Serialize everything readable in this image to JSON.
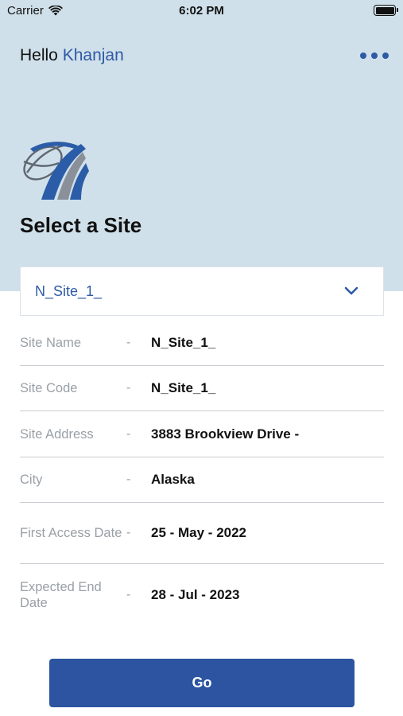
{
  "status_bar": {
    "carrier": "Carrier",
    "time": "6:02 PM"
  },
  "header": {
    "greeting": "Hello",
    "user_name": "Khanjan"
  },
  "page_title": "Select a Site",
  "site_select": {
    "selected": "N_Site_1_"
  },
  "details": [
    {
      "label": "Site Name",
      "separator": "-",
      "value": "N_Site_1_"
    },
    {
      "label": "Site Code",
      "separator": "-",
      "value": "N_Site_1_"
    },
    {
      "label": "Site Address",
      "separator": "-",
      "value": "3883 Brookview Drive -"
    },
    {
      "label": "City",
      "separator": "-",
      "value": "Alaska"
    },
    {
      "label": "First Access Date",
      "separator": "-",
      "value": "25 - May - 2022"
    },
    {
      "label": "Expected End Date",
      "separator": "-",
      "value": "28 - Jul - 2023"
    }
  ],
  "go_button": {
    "label": "Go"
  },
  "colors": {
    "header_bg": "#d0e0ea",
    "accent": "#2e5aa6",
    "button": "#2c54a0",
    "label_gray": "#9aa0a6"
  },
  "icons": {
    "wifi": "wifi-icon",
    "battery": "battery-icon",
    "more": "more-dots-icon",
    "dropdown": "chevron-down-icon",
    "logo": "globe-road-logo"
  }
}
